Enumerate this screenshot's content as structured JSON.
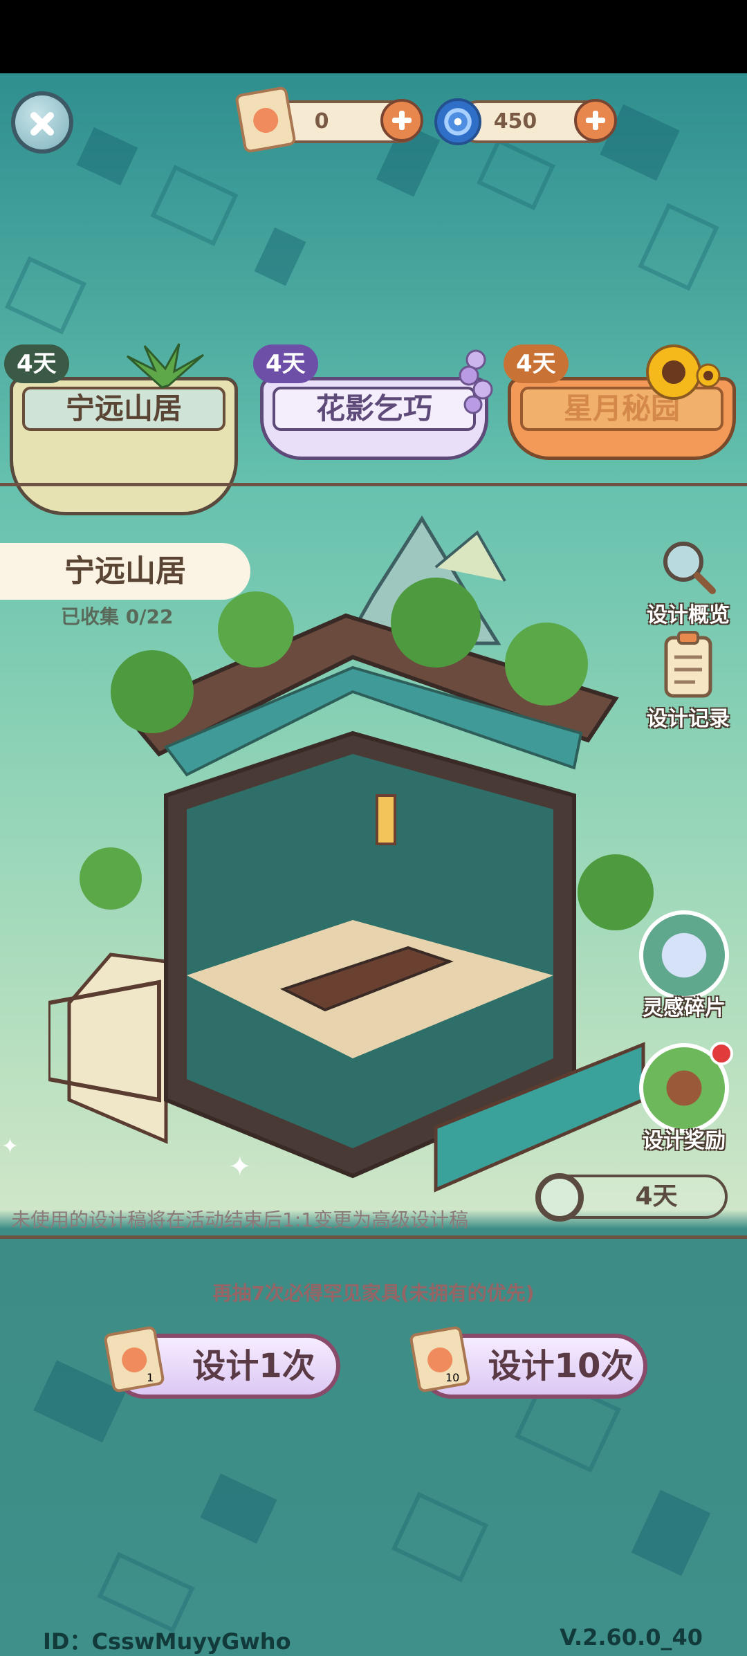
{
  "currencies": {
    "scroll": {
      "value": "0",
      "icon": "paw-scroll-icon"
    },
    "swirl": {
      "value": "450",
      "icon": "blue-swirl-icon"
    }
  },
  "tabs": [
    {
      "label": "宁远山居",
      "badge": "4天",
      "active": true
    },
    {
      "label": "花影乞巧",
      "badge": "4天",
      "active": false
    },
    {
      "label": "星月秘园",
      "badge": "4天",
      "active": false
    }
  ],
  "theme": {
    "name": "宁远山居",
    "collected": "已收集 0/22"
  },
  "side_buttons": {
    "overview": "设计概览",
    "records": "设计记录",
    "fragments": "灵感碎片",
    "rewards": "设计奖励"
  },
  "hint": "未使用的设计稿将在活动结束后1:1变更为高级设计稿",
  "timer": "4天",
  "notice": "再抽7次必得罕见家具(未拥有的优先)",
  "draw": {
    "once": {
      "label": "设计1次",
      "count": "1"
    },
    "ten": {
      "label": "设计10次",
      "count": "10"
    }
  },
  "footer": {
    "id": "ID：CsswMuyyGwho",
    "version": "V.2.60.0_40"
  }
}
